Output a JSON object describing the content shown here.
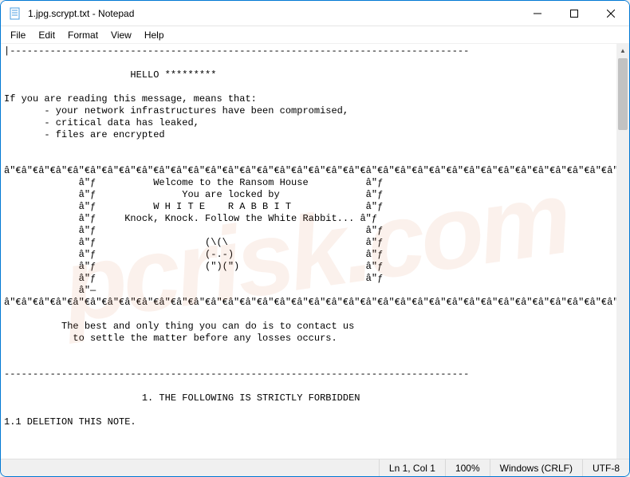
{
  "window": {
    "title": "1.jpg.scrypt.txt - Notepad"
  },
  "menu": {
    "file": "File",
    "edit": "Edit",
    "format": "Format",
    "view": "View",
    "help": "Help"
  },
  "content": {
    "text": "|--------------------------------------------------------------------------------\n\n                      HELLO *********\n\nIf you are reading this message, means that:\n       - your network infrastructures have been compromised,\n       - critical data has leaked,\n       - files are encrypted\n\n\nâ\"€â\"€â\"€â\"€â\"€â\"€â\"€â\"€â\"€â\"€â\"€â\"€â\"€â\"€â\"€â\"€â\"€â\"€â\"€â\"€â\"€â\"€â\"€â\"€â\"€â\"€â\"€â\"€â\"€â\"€â\"€â\"€â\"€â\"€â\"€â\"€â\"€â\"€â\"€â\"€â\"€â\"€â\"€â\"€â\"€â\"€â\"€â\"€â\"€â\"€â\"€â\"€â\"€â\"€â\"€â\"€â\"€â\"€â\"€â\"€â\"€â\"€â\"€â\"€â\"€â\"€â\"€â\"€â\"€â\"€â\"€â\"€â\"€â\"€â\"€â\"€â\"€â\"€â\"€â\"€â\"€â\"€â\"€â\"€â\"€â\"€â\"€â\"€â\"€â\"€â\"€â\"€â\"€â\"€â\"€â\"€â\"€â\"€â\"€â\"€â\"€â\"€â\"€â\"€â\"€â\"€â\"€â\"€â\"€â\"€â\"€â\"€â\"€â\"€â\"€â\"€â\"€â\"€â\"€â\"€â\"€â\"€â\"€â\"€â\"€â\"€â\"€â\"€â\"€â\"€â\"€â\"€â\"€â\"€â\"€â\"€â\"€â\"€â\"€â\"€â\"€â\"€â\"€â\"€â\"€â\"€â\"€â\"€â\"€â\"€â\"\"\n             â\"ƒ          Welcome to the Ransom House          â\"ƒ\n             â\"ƒ               You are locked by               â\"ƒ\n             â\"ƒ          W H I T E    R A B B I T             â\"ƒ\n             â\"ƒ     Knock, Knock. Follow the White Rabbit... â\"ƒ\n             â\"ƒ                                               â\"ƒ\n             â\"ƒ                   (\\(\\                        â\"ƒ\n             â\"ƒ                   (-.-)                       â\"ƒ\n             â\"ƒ                   (\")(\")                      â\"ƒ\n             â\"ƒ                                               â\"ƒ\n             â\"—\nâ\"€â\"€â\"€â\"€â\"€â\"€â\"€â\"€â\"€â\"€â\"€â\"€â\"€â\"€â\"€â\"€â\"€â\"€â\"€â\"€â\"€â\"€â\"€â\"€â\"€â\"€â\"€â\"€â\"€â\"€â\"€â\"€â\"€â\"€â\"€â\"€â\"€â\"€â\"€â\"€â\"€â\"€â\"€â\"€â\"€â\"€â\"€â\"€â\"€â\"€â\"€â\"€â\"€â\"€â\"€â\"€â\"€â\"€â\"€â\"€â\"€â\"€â\"€â\"€â\"€â\"€â\"€â\"€â\"€â\"€â\"€â\"€â\"€â\"€â\"€â\"€â\"€â\"€â\"€â\"€â\"€â\"€â\"€â\"€â\"€â\"€â\"€â\"€â\"€â\"€â\"€â\"€â\"€â\"€â\"€â\"€â\"€â\"€â\"€â\"€â\"€â\"€â\"€â\"€â\"€â\"€â\"€â\"€â\"€â\"€â\"€â\"€â\"€â\"€â\"€â\"€â\"€â\"€â\"€â\"€â\"€â\"€â\"€â\"€â\"€â\"€â\"€â\"€â\"€â\"€â\"€â\"€â\"€â\"€â\"€â\"€â\"€â\"€â\"€â\"€â\"€â\"€â\"€â\"€â\"€â\"€â\"€â\"€â\"€â\"€â\"›\n\n          The best and only thing you can do is to contact us\n            to settle the matter before any losses occurs.\n\n\n---------------------------------------------------------------------------------\n\n                        1. THE FOLLOWING IS STRICTLY FORBIDDEN\n\n1.1 DELETION THIS NOTE."
  },
  "status": {
    "position": "Ln 1, Col 1",
    "zoom": "100%",
    "lineend": "Windows (CRLF)",
    "encoding": "UTF-8"
  },
  "watermark": "pcrisk.com"
}
